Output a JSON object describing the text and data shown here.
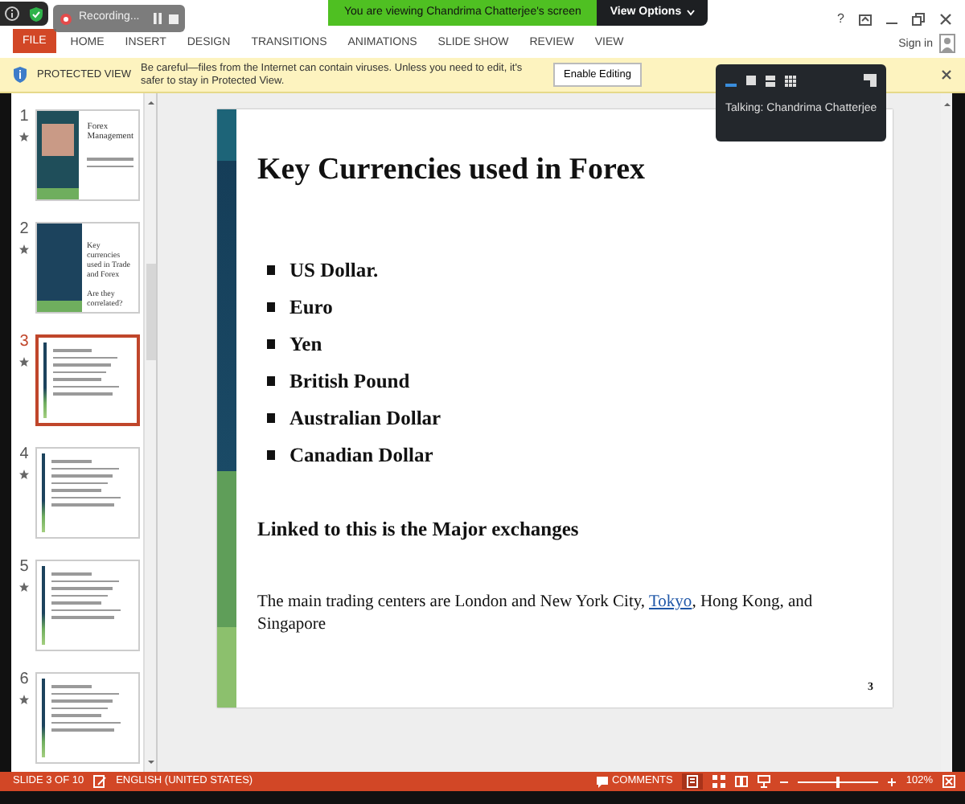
{
  "share_banner": {
    "text": "You are viewing Chandrima Chatterjee's screen",
    "button": "View Options"
  },
  "recording": {
    "label": "Recording..."
  },
  "title_bar": {
    "help": "?",
    "sign_in": "Sign in"
  },
  "ribbon_tabs": [
    {
      "label": "FILE",
      "kind": "file"
    },
    {
      "label": "HOME",
      "kind": "tab"
    },
    {
      "label": "INSERT",
      "kind": "tab"
    },
    {
      "label": "DESIGN",
      "kind": "tab"
    },
    {
      "label": "TRANSITIONS",
      "kind": "tab"
    },
    {
      "label": "ANIMATIONS",
      "kind": "tab"
    },
    {
      "label": "SLIDE SHOW",
      "kind": "tab"
    },
    {
      "label": "REVIEW",
      "kind": "tab"
    },
    {
      "label": "VIEW",
      "kind": "tab"
    }
  ],
  "protected_view": {
    "title": "PROTECTED VIEW",
    "message": "Be careful—files from the Internet can contain viruses. Unless you need to edit, it's safer to stay in Protected View.",
    "button": "Enable Editing"
  },
  "speaker_panel": {
    "talking": "Talking: Chandrima Chatterjee"
  },
  "thumbnails": [
    {
      "number": "1",
      "selected": false,
      "kind": "title",
      "texts": [
        "Forex Management"
      ]
    },
    {
      "number": "2",
      "selected": false,
      "kind": "section",
      "texts": [
        "Key currencies used in Trade and Forex",
        "Are they correlated?"
      ]
    },
    {
      "number": "3",
      "selected": true,
      "kind": "content"
    },
    {
      "number": "4",
      "selected": false,
      "kind": "content"
    },
    {
      "number": "5",
      "selected": false,
      "kind": "content"
    },
    {
      "number": "6",
      "selected": false,
      "kind": "content"
    }
  ],
  "slide": {
    "title": "Key Currencies used in Forex",
    "bullets": [
      "US Dollar.",
      "Euro",
      "Yen",
      "British Pound",
      "Australian Dollar",
      "Canadian Dollar"
    ],
    "subheading": "Linked to this is the Major exchanges",
    "body_before": "The main trading centers are London and New York City, ",
    "body_link": "Tokyo",
    "body_after": ", Hong Kong, and Singapore",
    "page_number": "3"
  },
  "status_bar": {
    "slide_info": "SLIDE 3 OF 10",
    "language": "ENGLISH (UNITED STATES)",
    "comments": "COMMENTS",
    "zoom_slider": {
      "level": 0.5
    },
    "zoom": "102%"
  }
}
